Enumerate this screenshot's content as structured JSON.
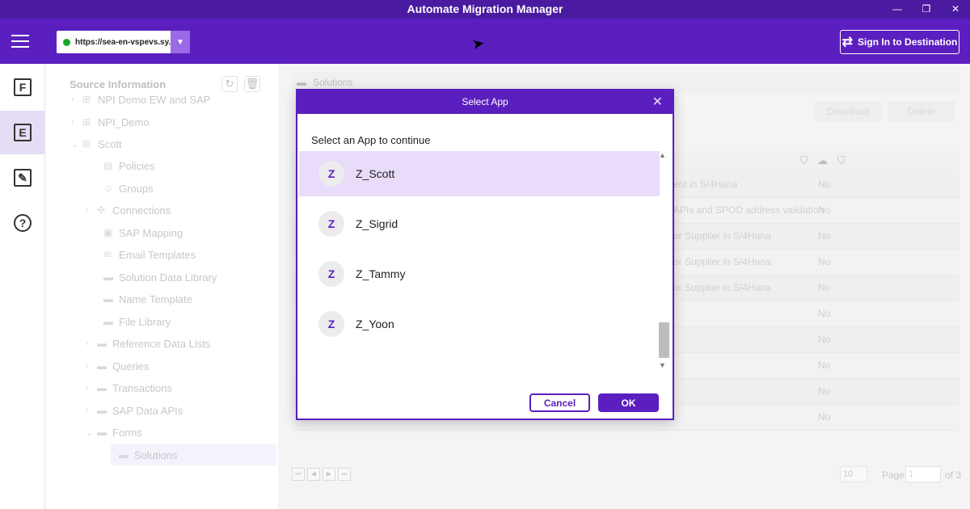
{
  "window": {
    "title": "Automate Migration Manager",
    "minimize": "—",
    "restore": "❐",
    "close": "✕"
  },
  "appbar": {
    "url": "https://sea-en-vspevs.sy...",
    "sign_in_label": "Sign In to Destination"
  },
  "leftnav": {
    "items": [
      {
        "label": "F"
      },
      {
        "label": "E"
      },
      {
        "label": "✎"
      },
      {
        "label": "?"
      }
    ]
  },
  "tree": {
    "title": "Source Information",
    "items": [
      {
        "label": "NPI Demo EW and SAP"
      },
      {
        "label": "NPI_Demo"
      },
      {
        "label": "Scott"
      },
      {
        "label": "Policies"
      },
      {
        "label": "Groups"
      },
      {
        "label": "Connections"
      },
      {
        "label": "SAP Mapping"
      },
      {
        "label": "Email Templates"
      },
      {
        "label": "Solution Data Library"
      },
      {
        "label": "Name Template"
      },
      {
        "label": "File Library"
      },
      {
        "label": "Reference Data Lists"
      },
      {
        "label": "Queries"
      },
      {
        "label": "Transactions"
      },
      {
        "label": "SAP Data APIs"
      },
      {
        "label": "Forms"
      },
      {
        "label": "Solutions"
      }
    ]
  },
  "main": {
    "breadcrumb": "Solutions",
    "download_label": "Download",
    "delete_label": "Delete",
    "rows": [
      {
        "desc": "ent in S/4Hana",
        "val": "No"
      },
      {
        "desc": "APIs and SPOD address validation",
        "val": "No"
      },
      {
        "desc": "or Supplier in S/4Hana",
        "val": "No"
      },
      {
        "desc": "or Supplier in S/4Hana",
        "val": "No"
      },
      {
        "desc": "or Supplier in S/4Hana",
        "val": "No"
      },
      {
        "desc": "",
        "val": "No"
      },
      {
        "desc": "",
        "val": "No"
      },
      {
        "desc": "",
        "val": "No"
      },
      {
        "desc": "",
        "val": "No"
      },
      {
        "desc": "",
        "val": "No"
      }
    ],
    "pager": {
      "page_size": "10",
      "page_label": "Page",
      "page_value": "1",
      "of_label": "of 3"
    }
  },
  "modal": {
    "title": "Select App",
    "subtitle": "Select an App to continue",
    "apps": [
      {
        "initial": "Z",
        "name": "Z_Scott",
        "selected": true
      },
      {
        "initial": "Z",
        "name": "Z_Sigrid",
        "selected": false
      },
      {
        "initial": "Z",
        "name": "Z_Tammy",
        "selected": false
      },
      {
        "initial": "Z",
        "name": "Z_Yoon",
        "selected": false
      }
    ],
    "cancel_label": "Cancel",
    "ok_label": "OK"
  },
  "colors": {
    "accent": "#5b1fbf",
    "titlebar": "#4a1aa0",
    "selected": "#e8dcfa"
  }
}
